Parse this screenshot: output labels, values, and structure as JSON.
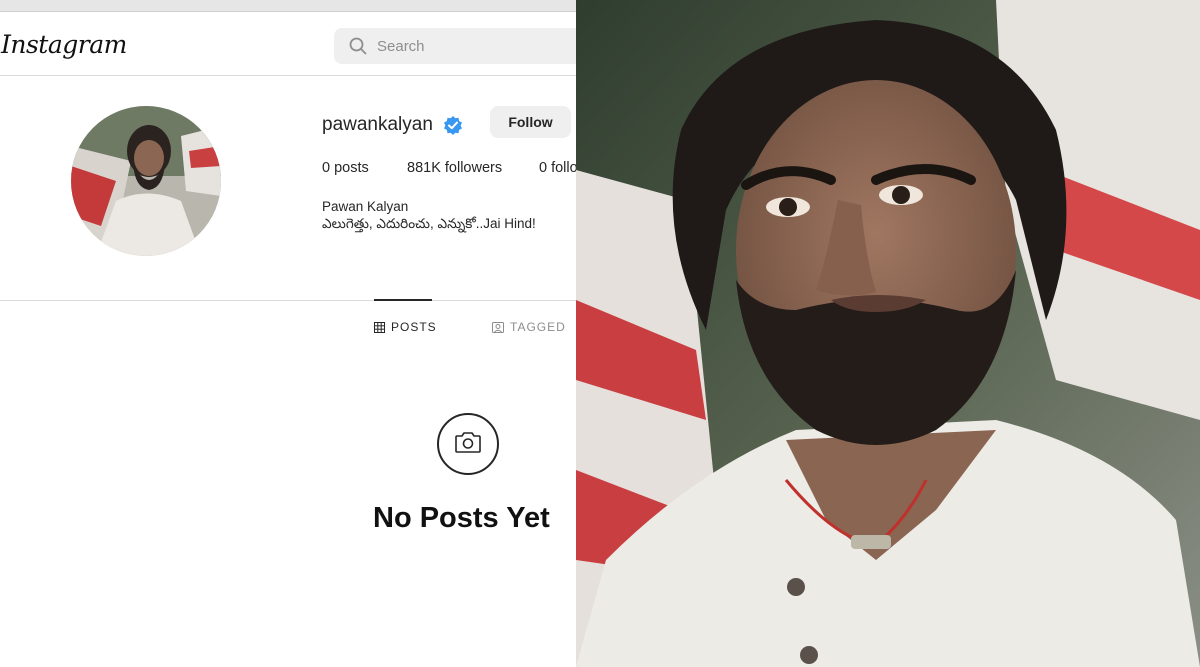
{
  "app": {
    "logo_text": "Instagram",
    "search_placeholder": "Search"
  },
  "profile": {
    "username": "pawankalyan",
    "verified": true,
    "follow_label": "Follow",
    "stats": {
      "posts": "0 posts",
      "followers": "881K followers",
      "following": "0 follo"
    },
    "full_name": "Pawan Kalyan",
    "bio": "ఎలుగెత్తు, ఎదురించు, ఎన్నుకో..Jai Hind!"
  },
  "tabs": {
    "posts": "POSTS",
    "tagged": "TAGGED"
  },
  "empty_state": {
    "title": "No Posts Yet",
    "icon": "camera-icon"
  },
  "colors": {
    "verified_blue": "#3897f0",
    "button_bg": "#efefef",
    "divider": "#dbdbdb"
  }
}
